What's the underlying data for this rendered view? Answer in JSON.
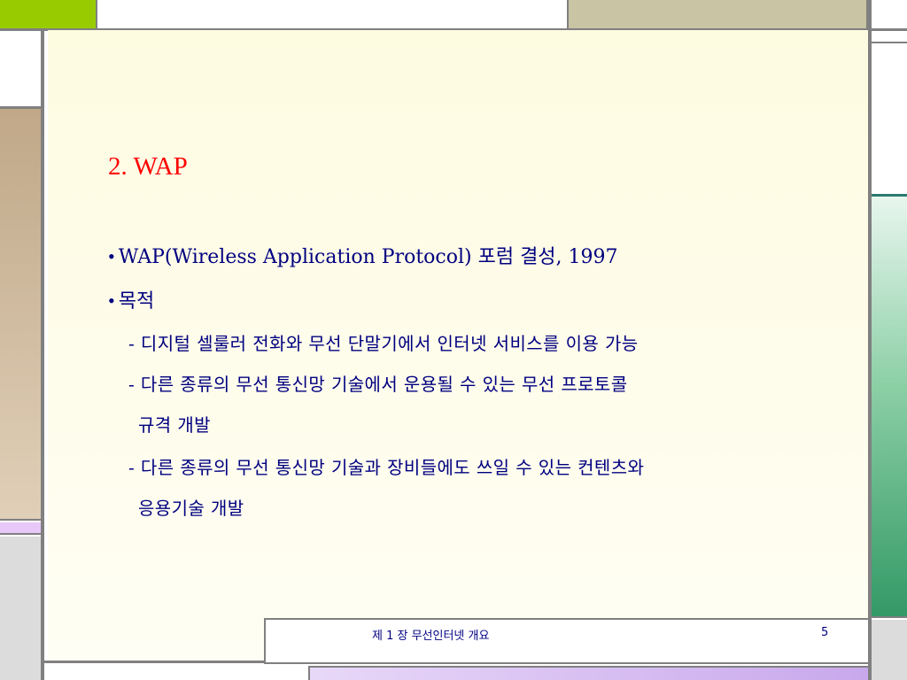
{
  "slide": {
    "title": "2. WAP",
    "bullets": [
      {
        "marker": "•",
        "text": "WAP(Wireless Application Protocol) 포럼 결성, 1997"
      },
      {
        "marker": "•",
        "text": "목적"
      }
    ],
    "sub_items": [
      "- 디지털 셀룰러 전화와 무선 단말기에서 인터넷 서비스를 이용 가능",
      "- 다른 종류의 무선 통신망 기술에서 운용될 수 있는 무선 프로토콜",
      "규격 개발",
      "- 다른 종류의 무선 통신망 기술과 장비들에도 쓰일 수 있는 컨텐츠와",
      "응용기술 개발"
    ]
  },
  "footer": {
    "chapter": "제 1 장 무선인터넷 개요",
    "page_number": "5"
  },
  "colors": {
    "title": "#ff0000",
    "body_text": "#000080",
    "green_accent": "#99cc00",
    "khaki_block": "#c8c4a4",
    "tan_block": "#c0a888",
    "teal_gradient_bottom": "#339966",
    "lavender_strip": "#e8c8f8"
  }
}
